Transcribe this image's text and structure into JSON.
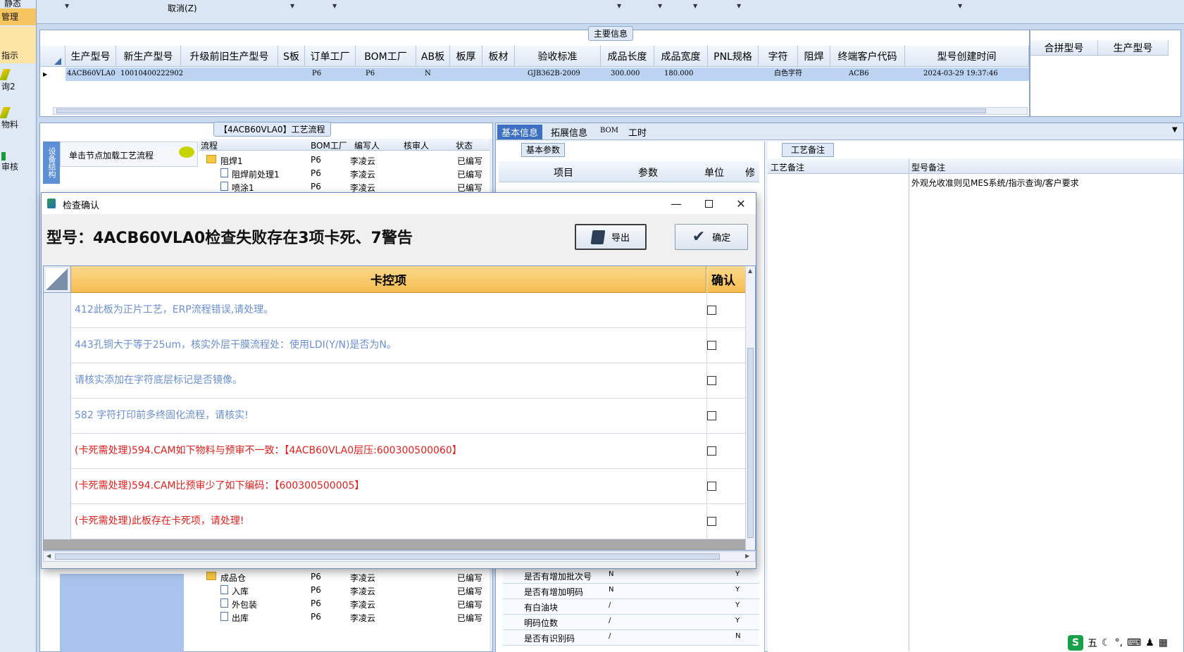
{
  "left_nav": {
    "items": [
      "静态",
      "管理",
      "指示",
      "询2",
      "物料",
      "审核"
    ]
  },
  "toolbar": {
    "cancel_label": "取消(Z)"
  },
  "main_info": {
    "group_title": "主要信息",
    "columns": [
      "生产型号",
      "新生产型号",
      "升级前旧生产型号",
      "S板",
      "订单工厂",
      "BOM工厂",
      "AB板",
      "板厚",
      "板材",
      "验收标准",
      "成品长度",
      "成品宽度",
      "PNL规格",
      "字符",
      "阻焊",
      "终端客户代码",
      "型号创建时间"
    ],
    "row": {
      "prod_model": "4ACB60VLA0",
      "new_model": "10010400222902",
      "order_factory": "P6",
      "bom_factory": "P6",
      "ab_board": "N",
      "standard": "GJB362B-2009",
      "length": "300.000",
      "width": "180.000",
      "character": "白色字符",
      "customer_code": "ACB6",
      "created": "2024-03-29 19:37:46"
    },
    "side_columns": [
      "合拼型号",
      "生产型号"
    ]
  },
  "process_flow": {
    "title": "【4ACB60VLA0】工艺流程",
    "side_tab": "设备结构",
    "hint": "单击节点加载工艺流程",
    "columns": [
      "流程",
      "BOM工厂",
      "编写人",
      "核审人",
      "状态"
    ],
    "rows_top": [
      {
        "name": "阻焊1",
        "factory": "P6",
        "writer": "李凌云",
        "status": "已编写"
      },
      {
        "name": "阻焊前处理1",
        "factory": "P6",
        "writer": "李凌云",
        "status": "已编写"
      },
      {
        "name": "喷涂1",
        "factory": "P6",
        "writer": "李凌云",
        "status": "已编写"
      }
    ],
    "rows_bottom": [
      {
        "name": "成品仓",
        "factory": "P6",
        "writer": "李凌云",
        "status": "已编写"
      },
      {
        "name": "入库",
        "factory": "P6",
        "writer": "李凌云",
        "status": "已编写"
      },
      {
        "name": "外包装",
        "factory": "P6",
        "writer": "李凌云",
        "status": "已编写"
      },
      {
        "name": "出库",
        "factory": "P6",
        "writer": "李凌云",
        "status": "已编写"
      }
    ]
  },
  "right_tabs": [
    "基本信息",
    "拓展信息",
    "BOM",
    "工时"
  ],
  "basic_params": {
    "tab": "基本参数",
    "columns": [
      "项目",
      "参数",
      "单位",
      "修"
    ],
    "rows": [
      {
        "item": "是否有增加批次号",
        "param": "N",
        "flag": "Y"
      },
      {
        "item": "是否有增加明码",
        "param": "N",
        "flag": "Y"
      },
      {
        "item": "有白油块",
        "param": "/",
        "flag": "Y"
      },
      {
        "item": "明码位数",
        "param": "/",
        "flag": "Y"
      },
      {
        "item": "是否有识别码",
        "param": "/",
        "flag": "N"
      }
    ]
  },
  "process_note": {
    "tab": "工艺备注",
    "col1": "工艺备注",
    "col2": "型号备注",
    "model_note": "外观允收准则见MES系统/指示查询/客户要求"
  },
  "dialog": {
    "title": "检查确认",
    "headline": "型号：4ACB60VLA0检查失败存在3项卡死、7警告",
    "export_label": "导出",
    "ok_label": "确定",
    "col_item": "卡控项",
    "col_confirm": "确认",
    "rows": [
      {
        "text": "412此板为正片工艺，ERP流程错误,请处理。",
        "level": "warn"
      },
      {
        "text": "443孔铜大于等于25um，核实外层干膜流程处：使用LDI(Y/N)是否为N。",
        "level": "warn"
      },
      {
        "text": "请核实添加在字符底层标记是否镜像。",
        "level": "warn"
      },
      {
        "text": "582 字符打印前多终固化流程，请核实!",
        "level": "warn"
      },
      {
        "text": "(卡死需处理)594.CAM如下物料与预审不一致：【4ACB60VLA0层压:600300500060】",
        "level": "err"
      },
      {
        "text": "(卡死需处理)594.CAM比预审少了如下编码：【600300500005】",
        "level": "err"
      },
      {
        "text": "(卡死需处理)此板存在卡死项，请处理!",
        "level": "err"
      }
    ]
  },
  "ime": {
    "label": "五"
  }
}
